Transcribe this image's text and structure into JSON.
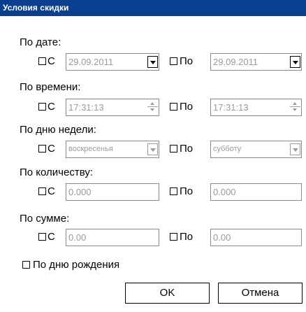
{
  "window": {
    "title": "Условия скидки"
  },
  "groups": {
    "date": {
      "label": "По дате:",
      "from_label": "С",
      "to_label": "По",
      "from_value": "29.09.2011",
      "to_value": "29.09.2011"
    },
    "time": {
      "label": "По времени:",
      "from_label": "С",
      "to_label": "По",
      "from_value": "17:31:13",
      "to_value": "17:31:13"
    },
    "weekday": {
      "label": "По дню недели:",
      "from_label": "С",
      "to_label": "По",
      "from_value": "воскресенья",
      "to_value": "субботу"
    },
    "quantity": {
      "label": "По количеству:",
      "from_label": "С",
      "to_label": "По",
      "from_value": "0.000",
      "to_value": "0.000"
    },
    "sum": {
      "label": "По сумме:",
      "from_label": "С",
      "to_label": "По",
      "from_value": "0.00",
      "to_value": "0.00"
    }
  },
  "birthday": {
    "label": "По дню рождения",
    "checked": false
  },
  "buttons": {
    "ok": "OK",
    "cancel": "Отмена"
  },
  "colors": {
    "titlebar": "#0a3e8e",
    "disabled_text": "#9a9a9a"
  }
}
